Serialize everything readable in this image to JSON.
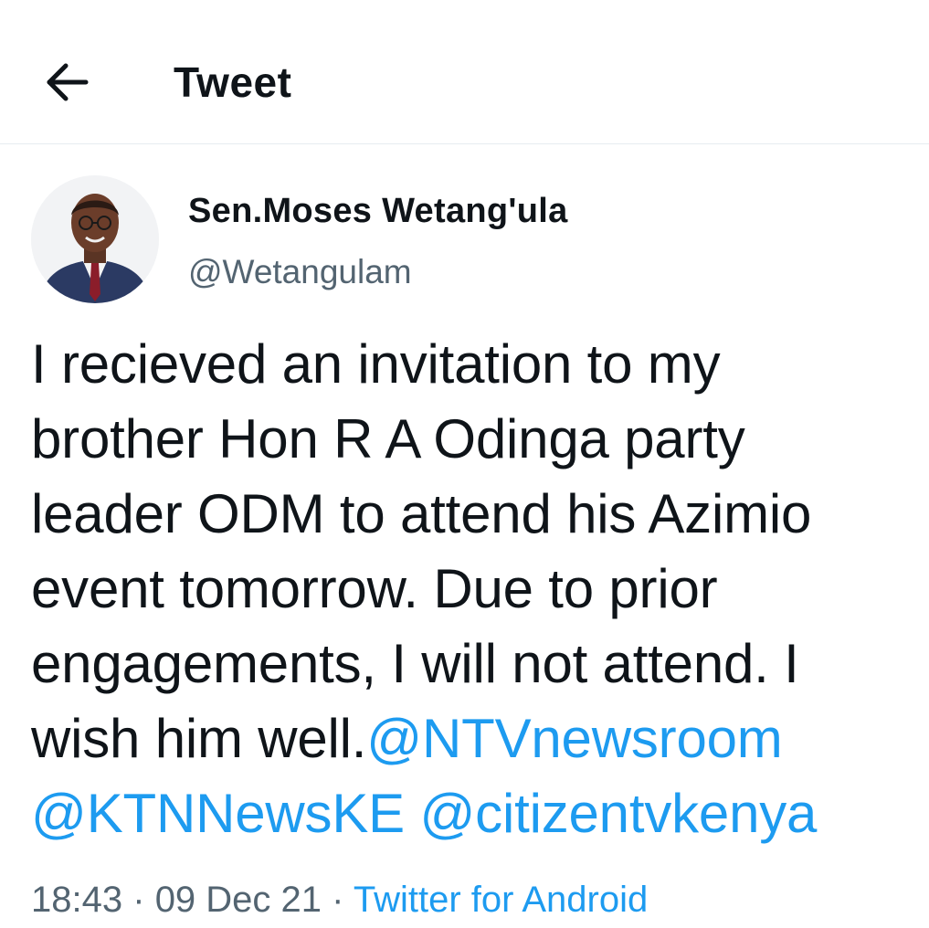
{
  "header": {
    "back_icon": "arrow-left-icon",
    "title": "Tweet"
  },
  "tweet": {
    "avatar_icon": "profile-photo",
    "display_name": "Sen.Moses Wetang'ula",
    "handle": "@Wetangulam",
    "lines": [
      "I recieved an invitation to my",
      "brother Hon R A Odinga party",
      "leader ODM to attend his Azimio",
      "event tomorrow. Due to prior",
      "engagements, I will not attend. I",
      "wish him well."
    ],
    "mentions": [
      "@NTVnewsroom",
      "@KTNNewsKE",
      "@citizentvkenya"
    ],
    "time": "18:43",
    "separator": "·",
    "date": "09 Dec 21",
    "source": "Twitter for Android"
  },
  "colors": {
    "link": "#1d9bf0",
    "secondary_text": "#536471",
    "primary_text": "#0f1419",
    "divider": "#e6ecf0"
  }
}
